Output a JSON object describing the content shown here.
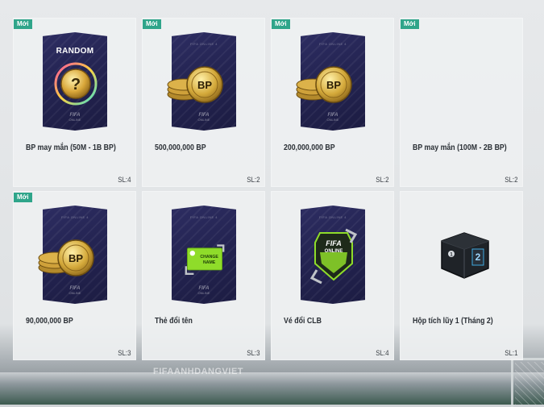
{
  "watermark": "FIFAANHDANGVIET",
  "items": [
    {
      "badge": "Mới",
      "name": "BP may mắn (50M - 1B BP)",
      "qty": "SL:4",
      "visual": "random-card",
      "card_title": "RANDOM",
      "icon": "question-coin-icon"
    },
    {
      "badge": "Mới",
      "name": "500,000,000 BP",
      "qty": "SL:2",
      "visual": "bp-card",
      "icon": "bp-coins-icon",
      "coin_label": "BP"
    },
    {
      "badge": "Mới",
      "name": "200,000,000 BP",
      "qty": "SL:2",
      "visual": "bp-card",
      "icon": "bp-coins-icon",
      "coin_label": "BP"
    },
    {
      "badge": "Mới",
      "name": "BP may mắn (100M - 2B BP)",
      "qty": "SL:2",
      "visual": "empty"
    },
    {
      "badge": "Mới",
      "name": "90,000,000 BP",
      "qty": "SL:3",
      "visual": "bp-card",
      "icon": "bp-coins-icon",
      "coin_label": "BP"
    },
    {
      "badge": "",
      "name": "Thẻ đổi tên",
      "qty": "SL:3",
      "visual": "change-name-card",
      "icon": "change-name-icon",
      "card_text": "CHANGE NAME"
    },
    {
      "badge": "",
      "name": "Vé đổi CLB",
      "qty": "SL:4",
      "visual": "club-card",
      "icon": "fifa-online-shield-icon",
      "card_text": "FIFA ONLINE"
    },
    {
      "badge": "",
      "name": "Hộp tích lũy 1 (Tháng 2)",
      "qty": "SL:1",
      "visual": "chest",
      "icon": "chest-icon",
      "chest_label": "2"
    }
  ],
  "colors": {
    "badge": "#2fa58a",
    "card": "#25255a",
    "coin": "#d4a93a"
  }
}
